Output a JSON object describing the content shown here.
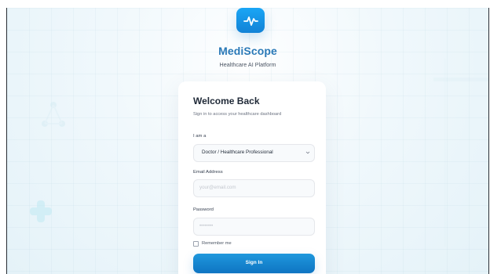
{
  "brand": {
    "name": "MediScope",
    "subtitle": "Healthcare AI Platform"
  },
  "card": {
    "title": "Welcome Back",
    "subtitle": "Sign in to access your healthcare dashboard"
  },
  "form": {
    "role_label": "I am a",
    "role_value": "Doctor / Healthcare Professional",
    "email_label": "Email Address",
    "email_placeholder": "your@email.com",
    "password_label": "Password",
    "password_value": "••••••••",
    "remember_label": "Remember me",
    "signin_label": "Sign In"
  },
  "icons": {
    "logo": "heartbeat-icon",
    "dropdown": "chevron-down-icon",
    "decor_left": "molecule-icon",
    "decor_plus": "medical-cross-icon"
  },
  "colors": {
    "brand_blue": "#2a79b7",
    "button_blue": "#1282d6",
    "logo_blue": "#1aa6f6"
  }
}
